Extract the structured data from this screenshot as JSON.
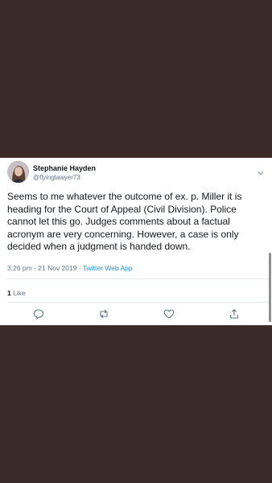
{
  "tweet": {
    "author_name": "Stephanie Hayden",
    "handle": "@flyinglawyer73",
    "text": "Seems to me whatever the outcome of ex. p. Miller it is\nheading for the Court of Appeal (Civil Division). Police\ncannot let this go. Judges comments about a factual\nacronym are very concerning. However, a case is only\ndecided when a judgment is handed down.",
    "time": "3:26 pm · 21 Nov 2019 · ",
    "source": "Twitter Web App",
    "like_count": "1",
    "like_label": " Like"
  },
  "icons": {
    "menu": "chevron-down-icon",
    "reply": "reply-icon",
    "retweet": "retweet-icon",
    "like": "heart-icon",
    "share": "share-icon"
  },
  "colors": {
    "background": "#3a2b29",
    "card": "#ffffff",
    "text": "#14171a",
    "secondary": "#657786",
    "link": "#1b95e0"
  }
}
